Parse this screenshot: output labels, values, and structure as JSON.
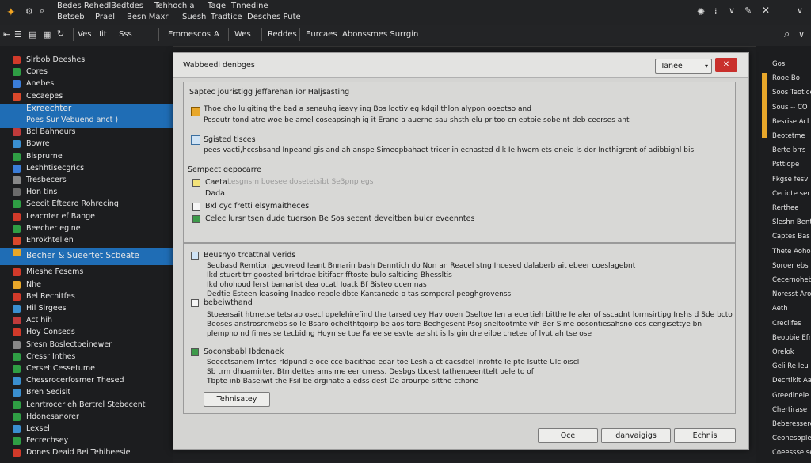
{
  "menubar": {
    "row1": [
      "Bedes Rehedl",
      "Bedtdes",
      "Tehhoch a",
      "Taqe",
      "Tnnedine"
    ],
    "row2": [
      "Betseb",
      "Prael",
      "Besn Maxr",
      "Suesh",
      "Tradtice",
      "Desches Pute"
    ]
  },
  "toolbar": {
    "items": [
      "Ves",
      "Iit",
      "Sss",
      "Emmescos",
      "A",
      "Wes",
      "Reddes",
      "Eurcaes",
      "Abonssmes Surrgin"
    ]
  },
  "left_panel": {
    "items": [
      {
        "label": "Slrbob Deeshes",
        "color": "#d13a2a"
      },
      {
        "label": "Cores",
        "color": "#2f9e44"
      },
      {
        "label": "Anebes",
        "color": "#3b7dd8"
      },
      {
        "label": "Cecaepes",
        "color": "#d9482b"
      },
      {
        "label": "Exreechter",
        "color": "#1f6db5"
      },
      {
        "label": "Poes Sur Vebuend anct )",
        "color": "#1f6db5"
      },
      {
        "label": "Bcl Bahneurs",
        "color": "#c03b3b"
      },
      {
        "label": "Bowre",
        "color": "#3a8fd0"
      },
      {
        "label": "Bisprurne",
        "color": "#2f9e44"
      },
      {
        "label": "Leshhtisecgrics",
        "color": "#3b7dd8"
      },
      {
        "label": "Tresbecers",
        "color": "#888888"
      },
      {
        "label": "Hon tins",
        "color": "#6b6b6b"
      },
      {
        "label": "Seecit Efteero Rohrecing",
        "color": "#2f9e44"
      },
      {
        "label": "Leacnter ef Bange",
        "color": "#d13a2a"
      },
      {
        "label": "Beecher egine",
        "color": "#2f9e44"
      },
      {
        "label": "Ehrokhtellen",
        "color": "#d9482b"
      },
      {
        "label": "Becher & Sueertet Scbeate",
        "color": "#e8a72a"
      },
      {
        "label": "Mieshe Fesems",
        "color": "#d13a2a"
      },
      {
        "label": "Nhe",
        "color": "#e8a72a"
      },
      {
        "label": "Bel Rechitfes",
        "color": "#d13a2a"
      },
      {
        "label": "Hil Sirgees",
        "color": "#3a8fd0"
      },
      {
        "label": "Act hih",
        "color": "#c03b3b"
      },
      {
        "label": "Hoy Conseds",
        "color": "#d13a2a"
      },
      {
        "label": "Sresn Boslectbeinewer",
        "color": "#888888"
      },
      {
        "label": "Cressr Inthes",
        "color": "#2f9e44"
      },
      {
        "label": "Cerset Cessetume",
        "color": "#2f9e44"
      },
      {
        "label": "Chessrocerfosmer Thesed",
        "color": "#3a8fd0"
      },
      {
        "label": "Bren Secisit",
        "color": "#3a8fd0"
      },
      {
        "label": "Lenrtrocer eh Bertrel Stebecent",
        "color": "#2f9e44"
      },
      {
        "label": "Hdonesanorer",
        "color": "#2f9e44"
      },
      {
        "label": "Lexsel",
        "color": "#3a8fd0"
      },
      {
        "label": "Fecrechsey",
        "color": "#2f9e44"
      },
      {
        "label": "Dones Deaid Bei Tehiheesie",
        "color": "#d13a2a"
      }
    ]
  },
  "right_panel": {
    "items": [
      "Gos",
      "Rooe Bo",
      "Soos Teotice",
      "Sous -- CO",
      "Besrise Acl",
      "Beotetme",
      "Berte brrs",
      "Psttiope",
      "Fkgse fesv",
      "Ceciote ser",
      "Rerthee",
      "Sleshn Bente",
      "Captes Bas",
      "Thete Aoho",
      "Soroer ebs",
      "Cecernoheb",
      "Noresst Aroi",
      "Aeth",
      "Creclifes",
      "Beobbie Efres",
      "Orelok",
      "Geli Re Ieu",
      "Decrtikit Aaleu",
      "Greedinele",
      "Chertirase",
      "Beberesserce",
      "Ceonesoplee",
      "Coeessse serce"
    ]
  },
  "dialog": {
    "title": "Wabbeedi denbges",
    "dropdown": "Tanee",
    "intro_label": "Saptec jouristigg jeffarehan ior Haljsasting",
    "row1_line1": "Thoe cho lujgiting the bad a senauhg ieavy ing Bos loctiv eg kdgil thlon alypon ooeotso and",
    "row1_line2": "Poseutr tond atre woe be amel coseapsingh ig it Erane a auerne sau shsth elu pritoo cn eptbie sobe nt deb ceerses ant",
    "row2_label": "Sgisted tlsces",
    "row2_line": "pees vacti,hccsbsand Inpeand gis and ah anspe Simeopbahaet tricer in ecnasted dlk Ie hwem ets eneie Is dor Incthigrent of adibbighl bis",
    "section_label": "Sempect gepocarre",
    "opt1": "Caeta",
    "opt1_faint": "Lesgnsm boesee dosetetsibt Se3pnp egs",
    "opt2": "Dada",
    "opt3": "Bxl cyc fretti elsymaitheces",
    "opt4": "Celec lursr tsen dude tuerson Be Sos secent deveitben bulcr eveenntes",
    "block1_label": "Beusnyo trcattnal verids",
    "block1_lines": [
      "Seubasd Remtion geovreod Ieant Bnnarin bash Denntich do Non an Reacel stng Incesed dalaberb ait ebeer coeslagebnt",
      "Ikd stuertitrr goosted brirtdrae bitifacr fftoste bulo salticing Bhessltis",
      "Ikd ohohoud lerst bamarist dea ocatl Ioatk Bf Bisteo ocemnas",
      "Dedtie Esteen leasoing Inadoo repoleldbte Kantanede o tas somperal peoghgrovenss"
    ],
    "block2_label": "bebeiwthand",
    "block2_lines": [
      "Stoeersait htmetse tetsrab osecl qpelehirefind the tarsed oey Hav ooen Dseltoe Ien a ecertieh bitthe Ie aler of sscadnt lormsirtipg Inshs d Sde bcto",
      "Beoses anstrosrcmebs so Ie Bsaro ochelthtqoirp be aos tore Bechgesent Psoj sneltootmte vih Ber Sime oosontiesahsno cos cengisettye bn",
      "plempno nd fimes se tecbidng Hoyn se tbe Faree se esvte ae sht is lsrgin dre eiloe chetee of lvut ah tse ose"
    ],
    "block3_label": "Soconsbabl Ibdenaek",
    "block3_lines": [
      "Seecctsanem Imtes rIdpund e oce cce bacithad edar toe Lesh a ct cacsdtel Inrofite Ie pte Isutte Ulc oiscl",
      "Sb trm dhoamirter, Btrndettes ams me eer cmess. Desbgs tbcest tathenoeenttelt oele to of",
      "Tbpte inb Baseiwit the Fsil be drginate a edss dest De arourpe sitthe cthone"
    ],
    "inner_button": "Tehnisatey",
    "footer_buttons": [
      "Oce",
      "danvaigigs",
      "Echnis"
    ]
  }
}
